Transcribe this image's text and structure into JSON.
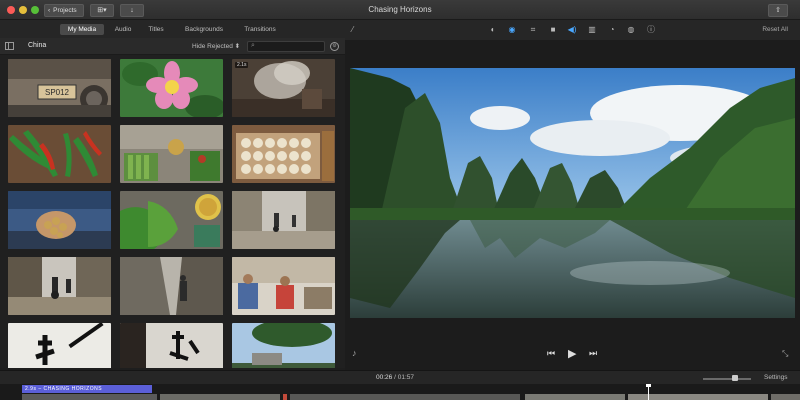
{
  "window": {
    "title": "Chasing Horizons",
    "projects_label": "Projects",
    "back_glyph": "‹",
    "media_glyph": "⊞▾",
    "import_glyph": "↓",
    "share_glyph": "⇧"
  },
  "browser": {
    "tabs": [
      "My Media",
      "Audio",
      "Titles",
      "Backgrounds",
      "Transitions"
    ],
    "active_tab": "My Media",
    "library_name": "China",
    "filter_label": "Hide Rejected",
    "filter_chevron": "⬍",
    "search_placeholder": "",
    "thumbnails": [
      {
        "id": "license-plate",
        "badge": ""
      },
      {
        "id": "pink-flower",
        "badge": ""
      },
      {
        "id": "steaming-pot",
        "badge": "2.1s"
      },
      {
        "id": "chili-peppers",
        "badge": ""
      },
      {
        "id": "market-vegetables",
        "badge": ""
      },
      {
        "id": "dumplings",
        "badge": ""
      },
      {
        "id": "hands-peanuts",
        "badge": ""
      },
      {
        "id": "greens-bowl",
        "badge": ""
      },
      {
        "id": "village-street",
        "badge": ""
      },
      {
        "id": "cyclists-street",
        "badge": ""
      },
      {
        "id": "alley-walker",
        "badge": ""
      },
      {
        "id": "courtyard-people",
        "badge": ""
      },
      {
        "id": "calligraphy-1",
        "badge": ""
      },
      {
        "id": "calligraphy-2",
        "badge": ""
      },
      {
        "id": "tree-sky",
        "badge": ""
      }
    ]
  },
  "viewer": {
    "reset_all_label": "Reset All",
    "toolbar_icons": [
      "color-balance-icon",
      "color-correction-icon",
      "crop-icon",
      "stabilization-icon",
      "volume-icon",
      "equalizer-icon",
      "speed-icon",
      "noise-reduction-icon",
      "filter-icon",
      "info-icon"
    ],
    "icon_glyphs": [
      "◐",
      "◉",
      "⌗",
      "■",
      "◀)",
      "▥",
      "◔",
      "◍",
      "●",
      "ⓘ"
    ],
    "wand_glyph": "⁄",
    "mic_glyph": "♪",
    "skip_back_glyph": "⏮",
    "play_glyph": "▶",
    "skip_forward_glyph": "⏭",
    "fullscreen_glyph": "⤡"
  },
  "bottom": {
    "current_time": "00:26",
    "separator": "/",
    "total_time": "01:57",
    "settings_label": "Settings",
    "zoom_level": 0.65
  },
  "timeline": {
    "title_clip_label": "2.9s – CHASING HORIZONS",
    "playhead_position_fraction": 0.81
  },
  "colors": {
    "accent_title_clip": "#5b5fd8",
    "active_icon": "#4aa8ff"
  }
}
